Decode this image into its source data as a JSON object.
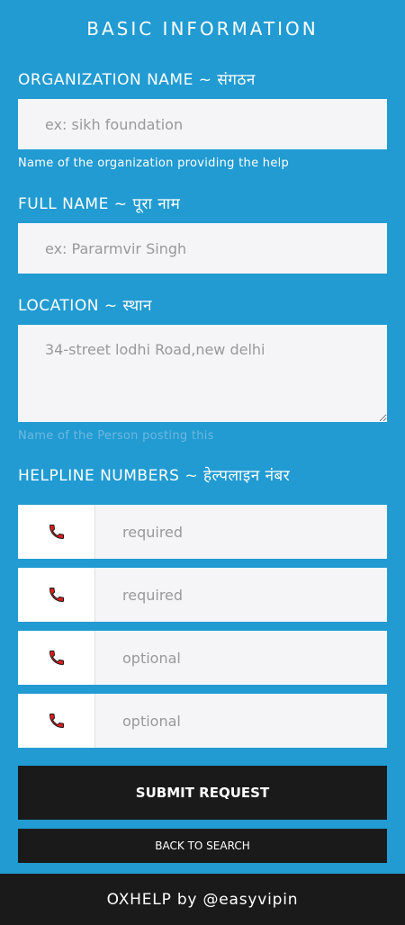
{
  "header": {
    "title": "BASIC INFORMATION"
  },
  "organization": {
    "label": "ORGANIZATION NAME ~ संगठन",
    "placeholder": "ex: sikh foundation",
    "help": "Name of the organization providing the help"
  },
  "full_name": {
    "label": "FULL NAME ~ पूरा नाम",
    "placeholder": "ex: Pararmvir Singh"
  },
  "location": {
    "label": "LOCATION ~ स्थान",
    "placeholder": "34-street lodhi Road,new delhi",
    "help": "Name of the Person posting this"
  },
  "helpline": {
    "label": "HELPLINE NUMBERS ~ हेल्पलाइन नंबर",
    "icon": "phone-icon",
    "icon_color": "#e51b1b",
    "fields": [
      {
        "placeholder": "required"
      },
      {
        "placeholder": "required"
      },
      {
        "placeholder": "optional"
      },
      {
        "placeholder": "optional"
      }
    ]
  },
  "buttons": {
    "submit": "SUBMIT REQUEST",
    "back": "BACK TO SEARCH"
  },
  "footer": {
    "text": "OXHELP by @easyvipin"
  },
  "colors": {
    "background": "#219bd2",
    "field": "#f5f5f7",
    "dark": "#1b1a1b"
  }
}
